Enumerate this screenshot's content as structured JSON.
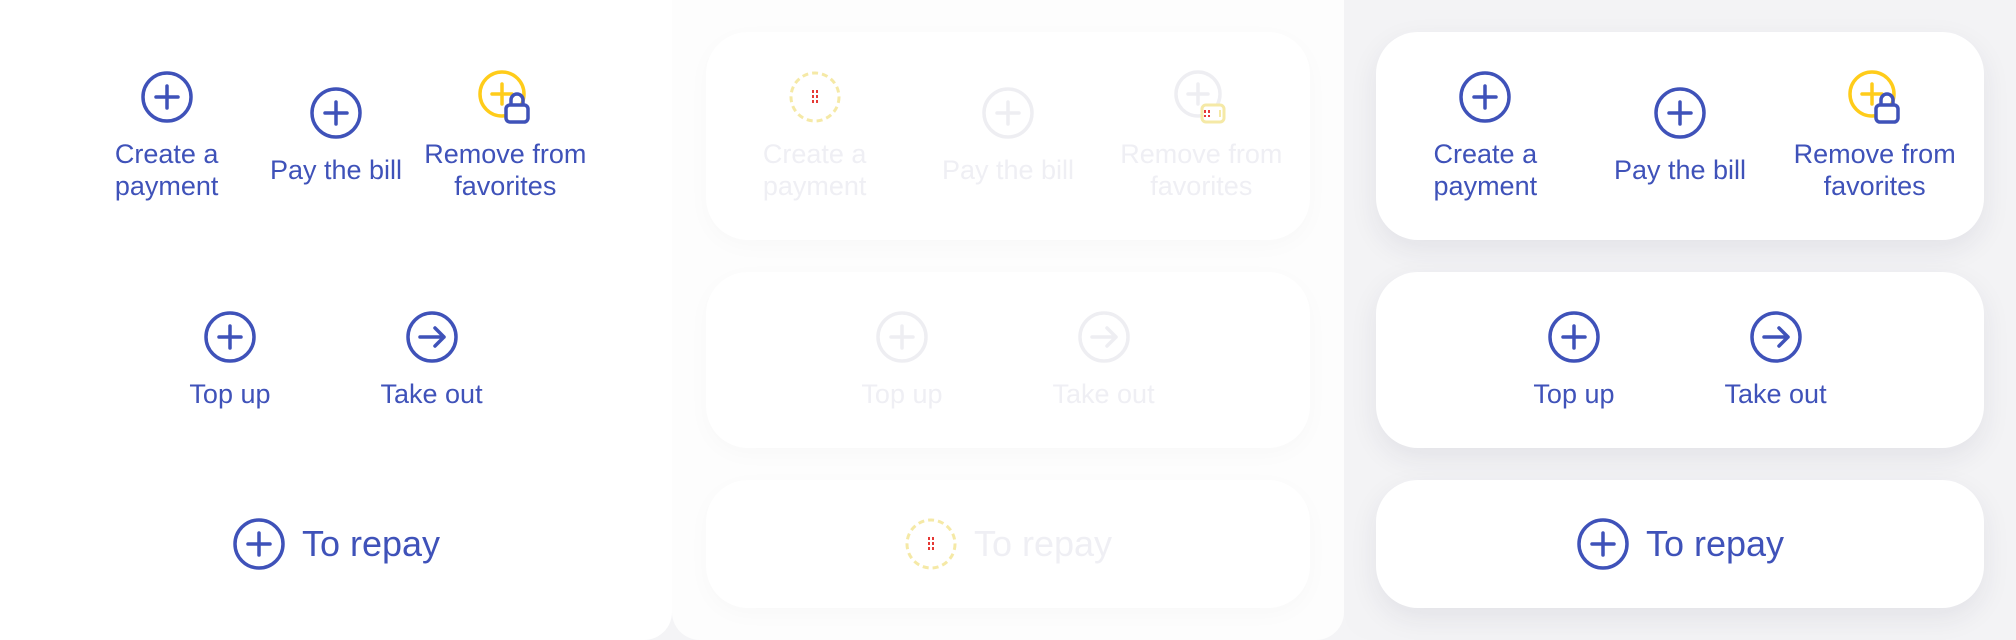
{
  "colors": {
    "primary": "#3f52b9",
    "lock_accent": "#ffcc1a",
    "faded": "#eeeef2",
    "loading_red": "#e53935",
    "loading_yellow": "#f5e9a6"
  },
  "panels": [
    {
      "state": "default",
      "row1": [
        {
          "label": "Create a payment",
          "icon": "plus-circle-icon"
        },
        {
          "label": "Pay the bill",
          "icon": "plus-circle-icon"
        },
        {
          "label": "Remove from favorites",
          "icon": "plus-circle-lock-icon"
        }
      ],
      "row2": [
        {
          "label": "Top up",
          "icon": "plus-circle-icon"
        },
        {
          "label": "Take out",
          "icon": "arrow-right-circle-icon"
        }
      ],
      "row3": {
        "label": "To repay",
        "icon": "plus-circle-icon"
      }
    },
    {
      "state": "disabled",
      "row1": [
        {
          "label": "Create a payment",
          "icon": "loading-circle-icon"
        },
        {
          "label": "Pay the bill",
          "icon": "plus-circle-icon"
        },
        {
          "label": "Remove from favorites",
          "icon": "plus-circle-lock-icon"
        }
      ],
      "row2": [
        {
          "label": "Top up",
          "icon": "plus-circle-icon"
        },
        {
          "label": "Take out",
          "icon": "arrow-right-circle-icon"
        }
      ],
      "row3": {
        "label": "To repay",
        "icon": "loading-circle-icon"
      }
    },
    {
      "state": "elevated",
      "row1": [
        {
          "label": "Create a payment",
          "icon": "plus-circle-icon"
        },
        {
          "label": "Pay the bill",
          "icon": "plus-circle-icon"
        },
        {
          "label": "Remove from favorites",
          "icon": "plus-circle-lock-icon"
        }
      ],
      "row2": [
        {
          "label": "Top up",
          "icon": "plus-circle-icon"
        },
        {
          "label": "Take out",
          "icon": "arrow-right-circle-icon"
        }
      ],
      "row3": {
        "label": "To repay",
        "icon": "plus-circle-icon"
      }
    }
  ]
}
